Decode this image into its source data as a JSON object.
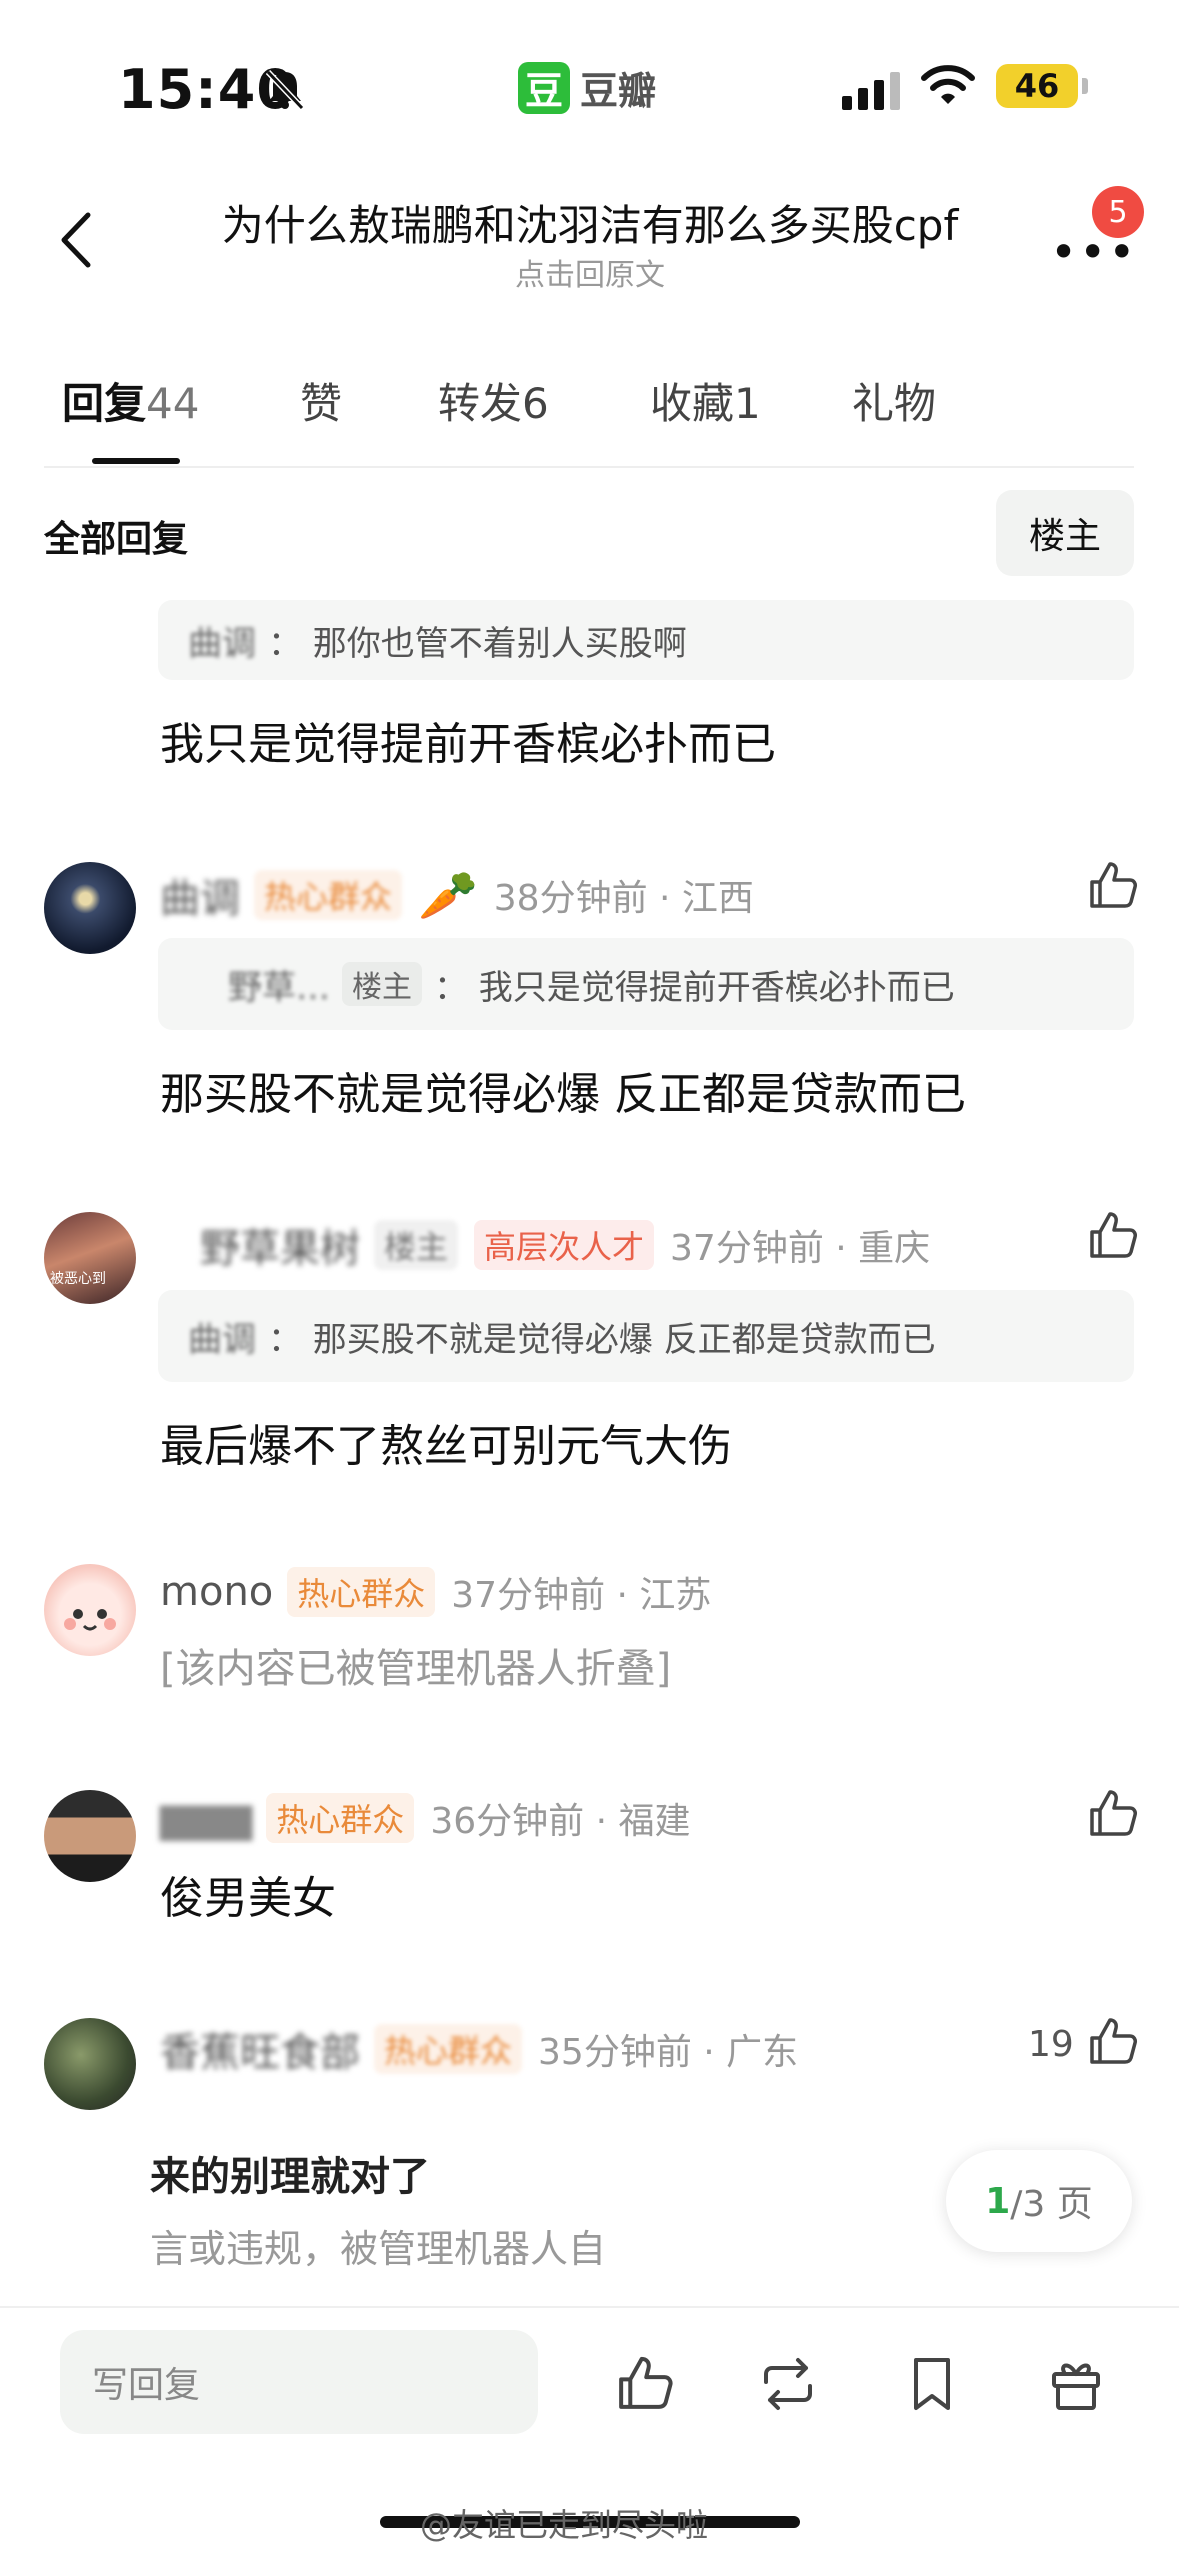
{
  "status_bar": {
    "time": "15:40",
    "app_logo": "豆",
    "app_name": "豆瓣",
    "battery": "46"
  },
  "header": {
    "title": "为什么敖瑞鹏和沈羽洁有那么多买股cpf",
    "subtitle": "点击回原文",
    "more": "•••",
    "badge": "5"
  },
  "tabs": [
    {
      "label": "回复",
      "count": "44"
    },
    {
      "label": "赞",
      "count": ""
    },
    {
      "label": "转发",
      "count": "6"
    },
    {
      "label": "收藏",
      "count": "1"
    },
    {
      "label": "礼物",
      "count": ""
    }
  ],
  "filter": {
    "all_replies": "全部回复",
    "op_button": "楼主"
  },
  "comments": [
    {
      "quote_name": "曲调",
      "quote_text": "：  那你也管不着别人买股啊",
      "body": "我只是觉得提前开香槟必扑而已"
    },
    {
      "name": "曲调",
      "tag": "热心群众",
      "emoji": "🥕",
      "time_loc": "38分钟前 · 江西",
      "quote_name": "野草…",
      "quote_op": "楼主",
      "quote_text": "：  我只是觉得提前开香槟必扑而已",
      "body": "那买股不就是觉得必爆 反正都是贷款而已"
    },
    {
      "name": "野草果树",
      "op": "楼主",
      "tag": "高层次人才",
      "time_loc": "37分钟前 · 重庆",
      "quote_name": "曲调",
      "quote_text": "：  那买股不就是觉得必爆 反正都是贷款而已",
      "body": "最后爆不了熬丝可别元气大伤",
      "avatar_text": "被恶心到"
    },
    {
      "name": "mono",
      "tag": "热心群众",
      "time_loc": "37分钟前 · 江苏",
      "folded": "[该内容已被管理机器人折叠]"
    },
    {
      "name": "▆▆▆",
      "tag": "热心群众",
      "time_loc": "36分钟前 · 福建",
      "body": "俊男美女"
    },
    {
      "name": "香蕉旺食部",
      "tag": "热心群众",
      "time_loc": "35分钟前 · 广东",
      "likes": "19",
      "partial_1": "来的别理就对了",
      "partial_2": "言或违规，被管理机器人自"
    }
  ],
  "pager": {
    "current": "1",
    "total": "/3 页"
  },
  "bottom_bar": {
    "reply_placeholder": "写回复"
  },
  "watermark": "@友谊已走到尽头啦",
  "colors": {
    "brand_green": "#2dbd3a",
    "tag_orange": "#e98a3a",
    "badge_red": "#f04b42",
    "pager_green": "#2da84b"
  },
  "icons": [
    "bell-slash-icon",
    "signal-icon",
    "wifi-icon",
    "battery-icon",
    "back-chevron-icon",
    "more-icon",
    "thumbs-up-icon",
    "repost-icon",
    "bookmark-icon",
    "gift-icon"
  ]
}
